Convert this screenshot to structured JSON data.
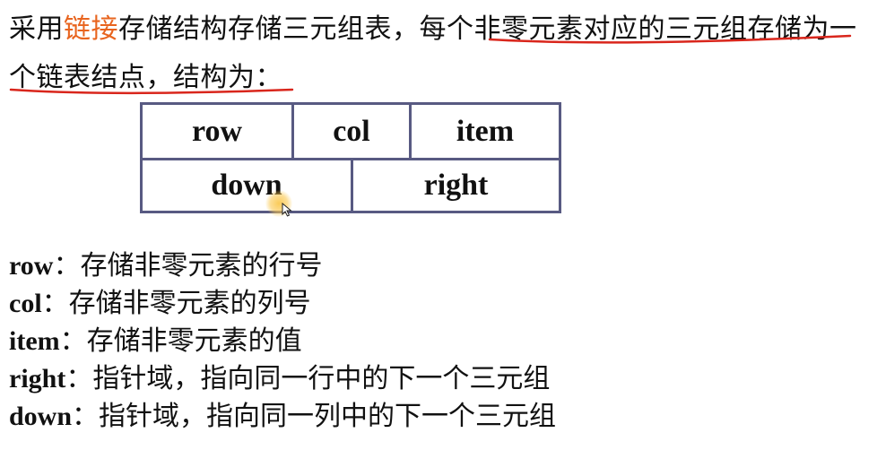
{
  "intro": {
    "prefix": "采用",
    "highlight": "链接",
    "middle": "存储结构存储三元组表，",
    "underlined_1": "每个非零元素对应的三元组",
    "underlined_2": "存储为一个链表结点",
    "suffix": "，结构为："
  },
  "node": {
    "top_row": [
      "row",
      "col",
      "item"
    ],
    "bottom_row": [
      "down",
      "right"
    ]
  },
  "fields": [
    {
      "name": "row",
      "sep": "：",
      "desc": "存储非零元素的行号"
    },
    {
      "name": "col",
      "sep": "：",
      "desc": "存储非零元素的列号"
    },
    {
      "name": "item",
      "sep": "：",
      "desc": "存储非零元素的值"
    },
    {
      "name": "right",
      "sep": "：",
      "desc": "指针域，指向同一行中的下一个三元组"
    },
    {
      "name": "down",
      "sep": "：",
      "desc": "指针域，指向同一列中的下一个三元组"
    }
  ],
  "colors": {
    "highlight": "#e8641e",
    "underline": "#d9261c",
    "table_border": "#585a82"
  }
}
